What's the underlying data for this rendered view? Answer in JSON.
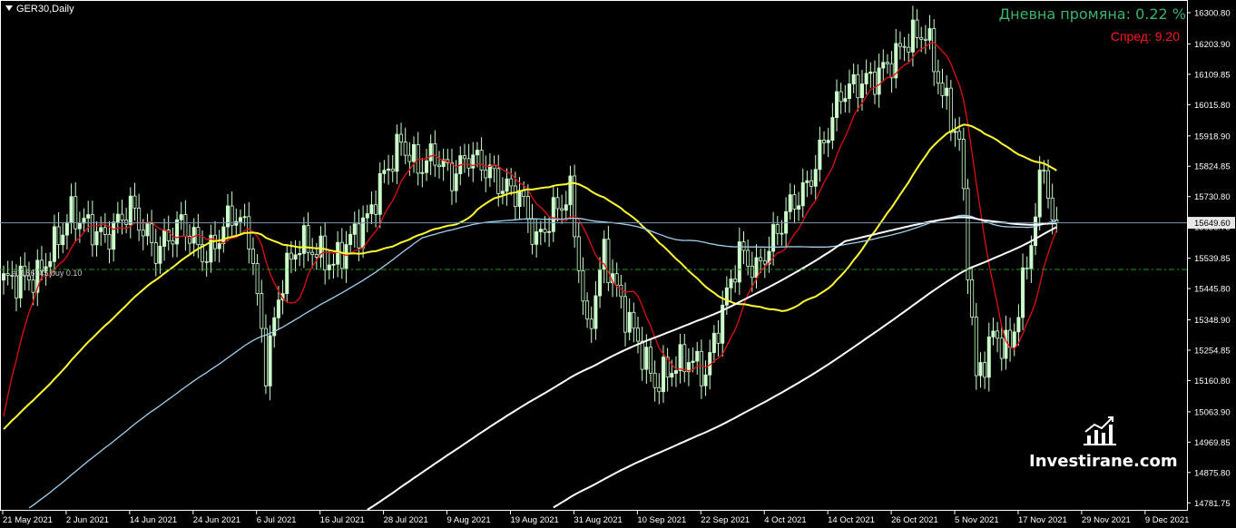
{
  "symbol_label": "GER30,Daily",
  "daily_change": "Дневна промяна: 0.22 %",
  "spread": "Спред: 9.20",
  "order_label": "#1186745  buy 0.10",
  "order_price": 15505,
  "current_price_label": "15649.60",
  "current_price": 15649.6,
  "brand": "Investirane.com",
  "colors": {
    "background": "#000000",
    "candle": "#ccffcc",
    "grid_text": "#ffffff",
    "ma_red": "#e01010",
    "ma_yellow": "#ffff33",
    "ma_blue": "#9fd0f0",
    "ma_white": "#ffffff",
    "order_line": "#1aa01a",
    "price_line": "#7a9ab0"
  },
  "chart_data": {
    "type": "candlestick",
    "y_ticks": [
      "16300.80",
      "16203.90",
      "16109.85",
      "16015.80",
      "15918.90",
      "15824.85",
      "15730.80",
      "15636.75",
      "15539.85",
      "15445.80",
      "15348.90",
      "15254.85",
      "15160.80",
      "15063.90",
      "14969.85",
      "14875.80",
      "14781.75"
    ],
    "ylim": [
      14760,
      16340
    ],
    "x_ticks": [
      "21 May 2021",
      "2 Jun 2021",
      "14 Jun 2021",
      "24 Jun 2021",
      "6 Jul 2021",
      "16 Jul 2021",
      "28 Jul 2021",
      "9 Aug 2021",
      "19 Aug 2021",
      "31 Aug 2021",
      "10 Sep 2021",
      "22 Sep 2021",
      "4 Oct 2021",
      "14 Oct 2021",
      "26 Oct 2021",
      "5 Nov 2021",
      "17 Nov 2021",
      "29 Nov 2021",
      "9 Dec 2021"
    ],
    "close_anchors": [
      [
        0,
        15470
      ],
      [
        8,
        15480
      ],
      [
        16,
        15680
      ],
      [
        24,
        15600
      ],
      [
        30,
        15700
      ],
      [
        36,
        15560
      ],
      [
        42,
        15650
      ],
      [
        48,
        15540
      ],
      [
        54,
        15680
      ],
      [
        58,
        15620
      ],
      [
        62,
        15200
      ],
      [
        66,
        15480
      ],
      [
        70,
        15590
      ],
      [
        74,
        15560
      ],
      [
        78,
        15520
      ],
      [
        82,
        15600
      ],
      [
        86,
        15660
      ],
      [
        90,
        15800
      ],
      [
        94,
        15900
      ],
      [
        98,
        15820
      ],
      [
        102,
        15860
      ],
      [
        106,
        15790
      ],
      [
        110,
        15860
      ],
      [
        114,
        15820
      ],
      [
        118,
        15760
      ],
      [
        122,
        15740
      ],
      [
        126,
        15590
      ],
      [
        130,
        15680
      ],
      [
        134,
        15740
      ],
      [
        138,
        15300
      ],
      [
        142,
        15560
      ],
      [
        146,
        15400
      ],
      [
        150,
        15280
      ],
      [
        154,
        15150
      ],
      [
        158,
        15200
      ],
      [
        162,
        15230
      ],
      [
        166,
        15180
      ],
      [
        170,
        15380
      ],
      [
        174,
        15560
      ],
      [
        178,
        15500
      ],
      [
        182,
        15600
      ],
      [
        186,
        15700
      ],
      [
        190,
        15760
      ],
      [
        194,
        15900
      ],
      [
        198,
        16050
      ],
      [
        202,
        16080
      ],
      [
        206,
        16100
      ],
      [
        210,
        16150
      ],
      [
        214,
        16220
      ],
      [
        218,
        16240
      ],
      [
        222,
        16050
      ],
      [
        226,
        15900
      ],
      [
        230,
        15160
      ],
      [
        234,
        15300
      ],
      [
        238,
        15260
      ],
      [
        242,
        15520
      ],
      [
        246,
        15840
      ],
      [
        248,
        15650
      ],
      [
        249,
        15650
      ]
    ],
    "moving_averages": [
      {
        "color": "red",
        "period": 10
      },
      {
        "color": "yellow",
        "period": 50
      },
      {
        "color": "lightblue",
        "period": 100
      },
      {
        "color": "white",
        "period": 200
      },
      {
        "color": "white",
        "period": 250
      }
    ]
  }
}
